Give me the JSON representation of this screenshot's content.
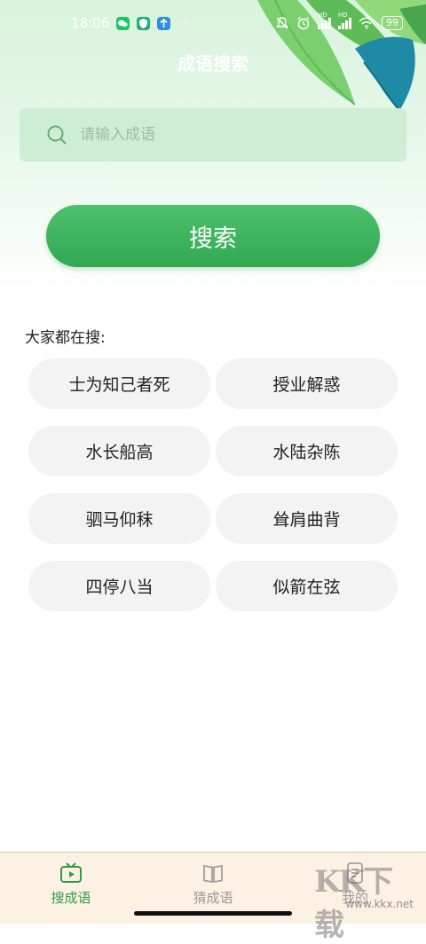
{
  "status_bar": {
    "time": "18:06",
    "more": "···",
    "battery": "99",
    "hd1": "HD",
    "hd2": "HD"
  },
  "header": {
    "title": "成语搜索"
  },
  "search": {
    "placeholder": "请输入成语",
    "button_label": "搜索"
  },
  "popular": {
    "title": "大家都在搜:",
    "items": [
      "士为知己者死",
      "授业解惑",
      "水长船高",
      "水陆杂陈",
      "驷马仰秣",
      "耸肩曲背",
      "四停八当",
      "似箭在弦"
    ]
  },
  "tabs": [
    {
      "label": "搜成语",
      "icon": "tv-play-icon",
      "active": true
    },
    {
      "label": "猜成语",
      "icon": "book-icon",
      "active": false
    },
    {
      "label": "我的",
      "icon": "document-icon",
      "active": false
    }
  ],
  "watermark": {
    "brand": "KK下载",
    "url": "www.kkx.net"
  },
  "colors": {
    "primary": "#3cb35c",
    "accent_green": "#2f9d44",
    "search_bg": "#cdeed4",
    "tag_bg": "#f3f3f3",
    "tabbar_bg": "#fdf1e4"
  }
}
